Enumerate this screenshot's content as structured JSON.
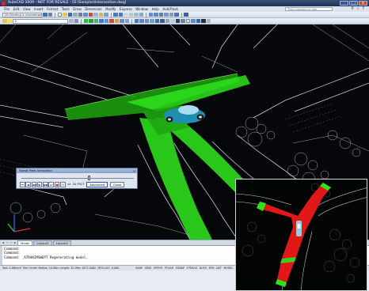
{
  "window": {
    "title": "AutoCAD 2009 - NOT FOR RESALE - [D:\\Samples\\Intersection.dwg]",
    "controls": [
      "_",
      "□",
      "x"
    ]
  },
  "menubar": {
    "items": [
      "File",
      "Edit",
      "View",
      "Insert",
      "Format",
      "Tools",
      "Draw",
      "Dimension",
      "Modify",
      "Express",
      "Window",
      "Help",
      "AutoTrack"
    ],
    "help_placeholder": "Type a question for help"
  },
  "toolbar1": {
    "workspace": "2D Drafting & Annotation"
  },
  "toolbar2": {
    "layer": "0"
  },
  "tabs": {
    "items": [
      "Model",
      "Layout1",
      "Layout2"
    ],
    "active": "Model"
  },
  "command": {
    "lines": [
      "Command:",
      "Command:",
      "Command: _ATRANIMSWEPT Regenerating model."
    ]
  },
  "status": {
    "coords": "Tool: 0.0Bench Tiler Center Radius: 10.0ftm Length: 32.0ftm  1872.0082, 2870.047, 0.000",
    "toggles": [
      "SNAP",
      "GRID",
      "ORTHO",
      "POLAR",
      "OSNAP",
      "OTRACK",
      "DUCS",
      "DYN",
      "LWT",
      "MODEL"
    ]
  },
  "dialog": {
    "title": "Swept Path Animation",
    "close_icon": "close-icon",
    "frame_of": "of",
    "frame_total": "34 FRCT",
    "advanced_label": "Advanced",
    "close_label": "Close",
    "progress": 0.6,
    "buttons": [
      "⏮",
      "◀",
      "◀◀",
      "▶",
      "▶▶",
      "⏭",
      "●",
      "⟲"
    ]
  },
  "colors": {
    "swept_path": "#2ee31c",
    "swept_path_dark": "#1b9a12",
    "vehicle": "#25a8c8",
    "inset_path": "#e01818",
    "cad_lines": "#c8ccd2"
  }
}
